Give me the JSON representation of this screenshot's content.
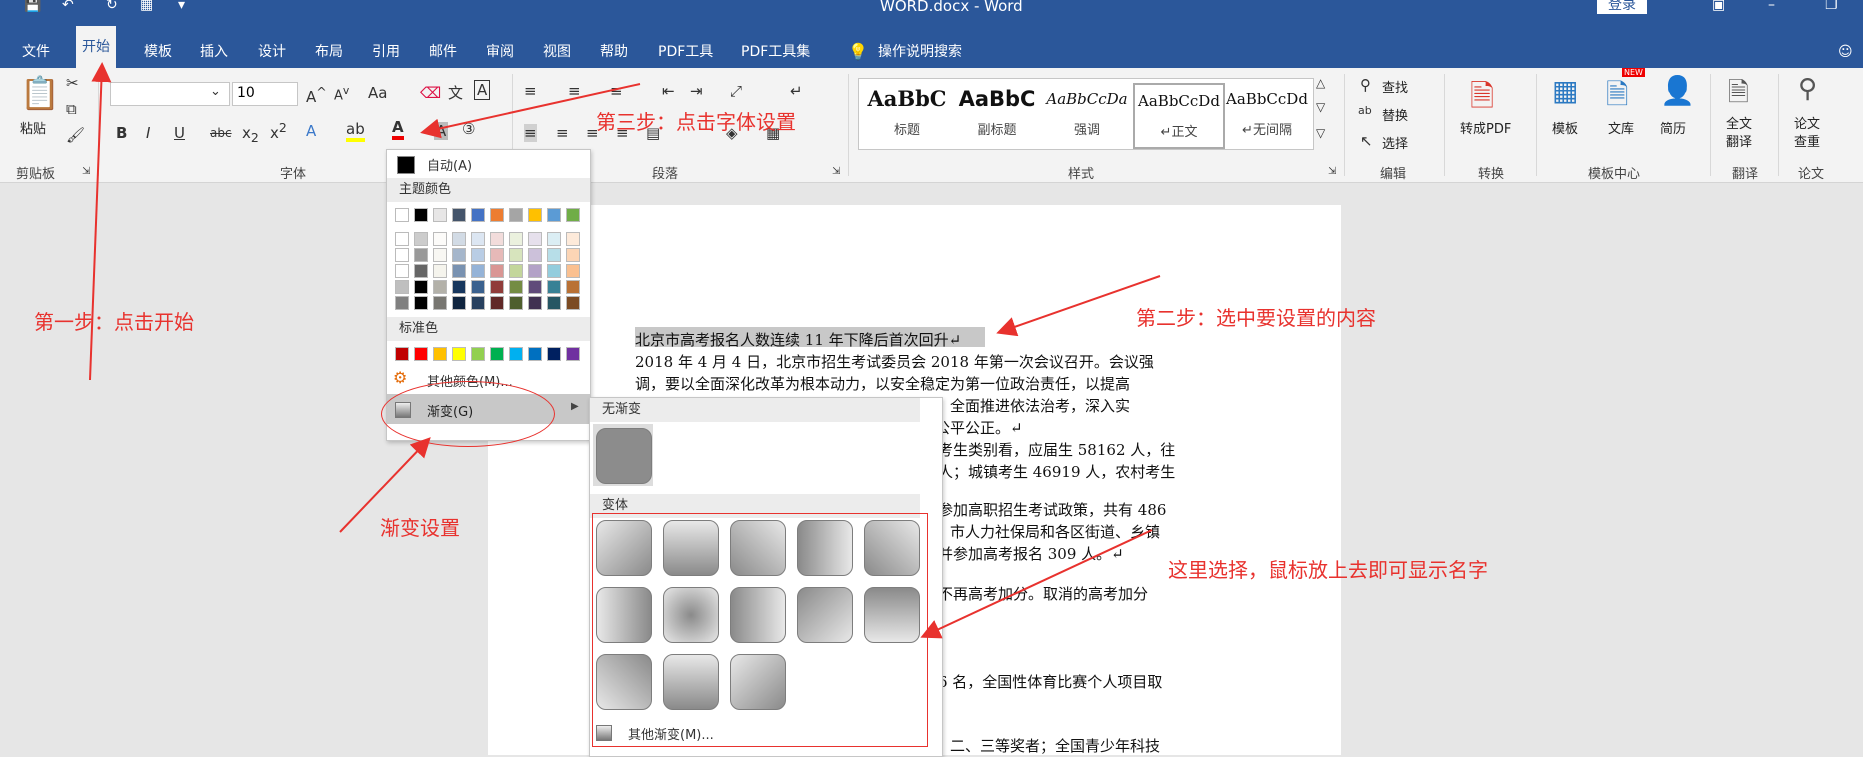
{
  "window": {
    "title": "WORD.docx - Word",
    "login": "登录"
  },
  "tabs": [
    {
      "label": "文件"
    },
    {
      "label": "开始"
    },
    {
      "label": "模板"
    },
    {
      "label": "插入"
    },
    {
      "label": "设计"
    },
    {
      "label": "布局"
    },
    {
      "label": "引用"
    },
    {
      "label": "邮件"
    },
    {
      "label": "审阅"
    },
    {
      "label": "视图"
    },
    {
      "label": "帮助"
    },
    {
      "label": "PDF工具"
    },
    {
      "label": "PDF工具集"
    },
    {
      "label": "操作说明搜索"
    }
  ],
  "ribbon": {
    "paste": "粘贴",
    "font_size": "10",
    "groups": [
      "剪贴板",
      "字体",
      "段落",
      "样式",
      "编辑",
      "转换",
      "模板中心",
      "翻译",
      "论文"
    ],
    "styles": [
      {
        "preview": "AaBbC",
        "label": "标题"
      },
      {
        "preview": "AaBbC",
        "label": "副标题"
      },
      {
        "preview": "AaBbCcDa",
        "label": "强调"
      },
      {
        "preview": "AaBbCcDd",
        "label": "↵正文"
      },
      {
        "preview": "AaBbCcDd",
        "label": "↵无间隔"
      }
    ],
    "edit": {
      "find": "查找",
      "replace": "替换",
      "select": "选择"
    },
    "convert": "转成PDF",
    "template": "模板",
    "library": "文库",
    "resume": "简历",
    "new_badge": "NEW",
    "translate": "全文\n翻译",
    "check": "论文\n查重"
  },
  "color_menu": {
    "auto": "自动(A)",
    "theme_header": "主题颜色",
    "standard_header": "标准色",
    "more_colors": "其他颜色(M)...",
    "gradient": "渐变(G)",
    "theme_top": [
      "#ffffff",
      "#000000",
      "#e7e6e6",
      "#44546a",
      "#4472c4",
      "#ed7d31",
      "#a5a5a5",
      "#ffc000",
      "#5b9bd5",
      "#70ad47"
    ],
    "theme_colors": [
      "#ffffff",
      "#000000",
      "#eeece1",
      "#1f497d",
      "#4f81bd",
      "#c0504d",
      "#9bbb59",
      "#8064a2",
      "#4bacc6",
      "#f79646"
    ],
    "standard_colors": [
      "#c00000",
      "#ff0000",
      "#ffc000",
      "#ffff00",
      "#92d050",
      "#00b050",
      "#00b0f0",
      "#0070c0",
      "#002060",
      "#7030a0"
    ]
  },
  "gradient_menu": {
    "none_header": "无渐变",
    "variants_header": "变体",
    "more": "其他渐变(M)..."
  },
  "document": {
    "lines": [
      "北京市高考报名人数连续 11 年下降后首次回升↵",
      "2018 年 4 月 4 日，北京市招生考试委员会 2018 年第一次会议召开。会议强",
      "调，要以全面深化改革为根本动力，以安全稳定为第一位政治责任，以提高",
      "人才选拔质量和促进考试招生公平为核心任务，全面推进依法治考，深入实",
      "施阳光工程，确保考试招生工作平稳、有序、公平公正。↵",
      "考生类别看，应届生 58162 人，往",
      "人；城镇考生 46919 人，农村考生",
      "参加高职招生考试政策，共有 486",
      "市人力社保局和各区街道、乡镇",
      "并参加高考报名 309 人。↵",
      "不再高考加分。取消的高考加分",
      "6 名，全国性体育比赛个人项目取",
      "二、三等奖者；全国青少年科技"
    ]
  },
  "annotations": {
    "step1": "第一步：点击开始",
    "step2": "第二步：选中要设置的内容",
    "step3": "第三步：点击字体设置",
    "gradient": "渐变设置",
    "hover": "这里选择，鼠标放上去即可显示名字"
  },
  "colors": {
    "accent": "#2b579a",
    "annotation": "#e8322e"
  }
}
